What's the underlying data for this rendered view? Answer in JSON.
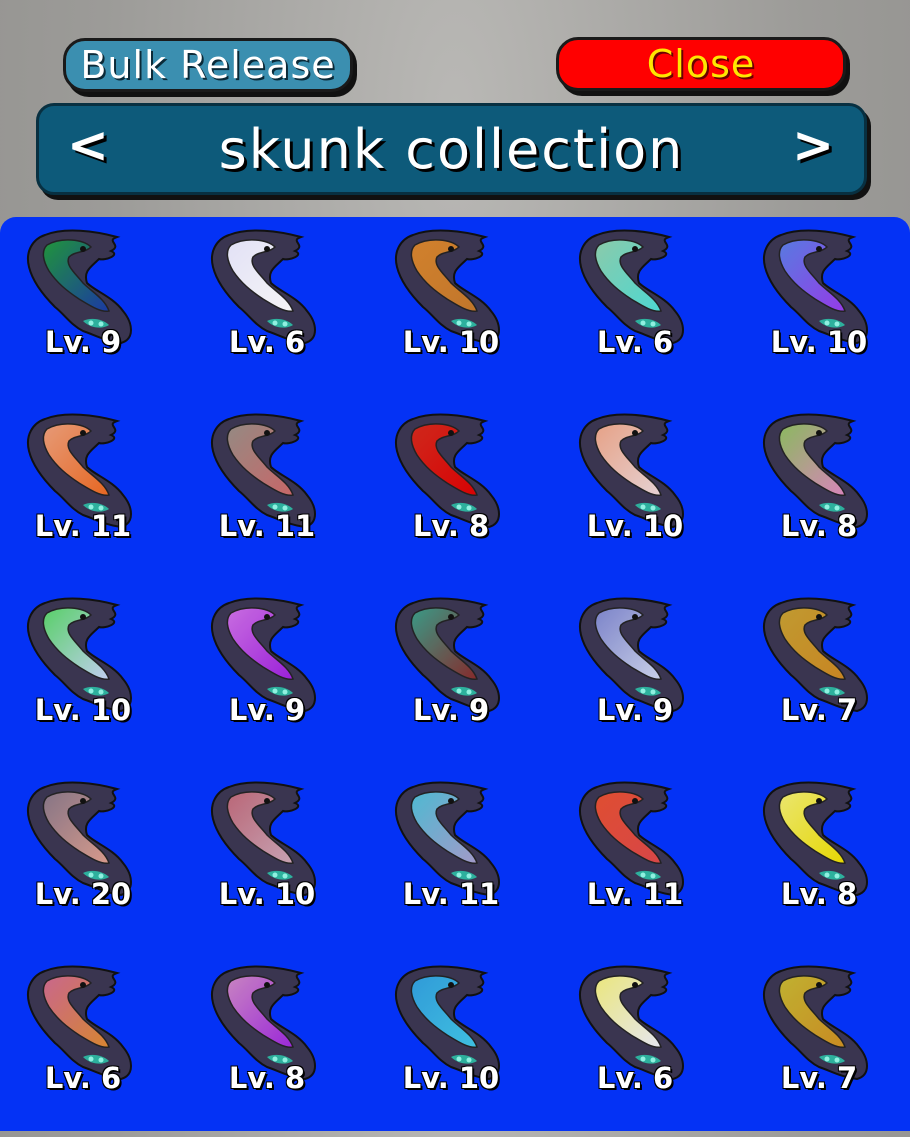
{
  "buttons": {
    "bulk_release": "Bulk Release",
    "close": "Close"
  },
  "header": {
    "title": "skunk collection",
    "prev": "<",
    "next": ">"
  },
  "colors": {
    "panel": "#0432f5",
    "header": "#0d5a7a",
    "bulk": "#3b8fb0",
    "close": "#ff0000",
    "close_text": "#ffe600"
  },
  "pets": [
    {
      "level": "Lv. 9",
      "color": "#1f9a3a",
      "color2": "#1a3aa8"
    },
    {
      "level": "Lv. 6",
      "color": "#ecebff",
      "color2": "#ffffff"
    },
    {
      "level": "Lv. 10",
      "color": "#d9852c",
      "color2": "#c97a2a"
    },
    {
      "level": "Lv. 6",
      "color": "#8fd3b0",
      "color2": "#4fe0d8"
    },
    {
      "level": "Lv. 10",
      "color": "#5a7fe8",
      "color2": "#9a3cf0"
    },
    {
      "level": "Lv. 11",
      "color": "#f0a07a",
      "color2": "#f06a20"
    },
    {
      "level": "Lv. 11",
      "color": "#9a8f86",
      "color2": "#d06a6a"
    },
    {
      "level": "Lv. 8",
      "color": "#d8281a",
      "color2": "#e00000"
    },
    {
      "level": "Lv. 10",
      "color": "#f0a88a",
      "color2": "#f0dada"
    },
    {
      "level": "Lv. 8",
      "color": "#8fc060",
      "color2": "#e08ac0"
    },
    {
      "level": "Lv. 10",
      "color": "#5ad86a",
      "color2": "#c8d8f8"
    },
    {
      "level": "Lv. 9",
      "color": "#d070e8",
      "color2": "#a020e0"
    },
    {
      "level": "Lv. 9",
      "color": "#3aa08a",
      "color2": "#8a2a2a"
    },
    {
      "level": "Lv. 9",
      "color": "#8088d0",
      "color2": "#d0d8f0"
    },
    {
      "level": "Lv. 7",
      "color": "#c8a030",
      "color2": "#d08a20"
    },
    {
      "level": "Lv. 20",
      "color": "#8a7888",
      "color2": "#e0a090"
    },
    {
      "level": "Lv. 10",
      "color": "#c06a7a",
      "color2": "#d0a8b8"
    },
    {
      "level": "Lv. 11",
      "color": "#50c0d8",
      "color2": "#a8a0d0"
    },
    {
      "level": "Lv. 11",
      "color": "#e85030",
      "color2": "#e04848"
    },
    {
      "level": "Lv. 8",
      "color": "#f4f070",
      "color2": "#f0e000"
    },
    {
      "level": "Lv. 6",
      "color": "#d06a90",
      "color2": "#e08a30"
    },
    {
      "level": "Lv. 8",
      "color": "#d088c8",
      "color2": "#a028e0"
    },
    {
      "level": "Lv. 10",
      "color": "#30a0e0",
      "color2": "#40c8e8"
    },
    {
      "level": "Lv. 6",
      "color": "#f4f080",
      "color2": "#f0f0f8"
    },
    {
      "level": "Lv. 7",
      "color": "#c8b830",
      "color2": "#d09020"
    }
  ]
}
